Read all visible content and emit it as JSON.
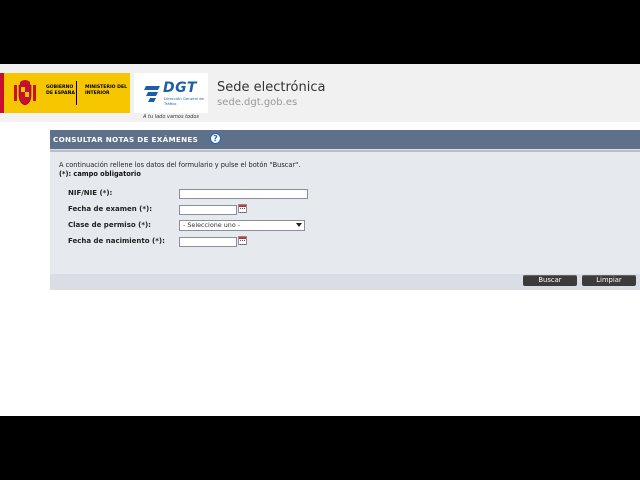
{
  "header": {
    "gov_line1": "GOBIERNO DE ESPAÑA",
    "gov_line2": "MINISTERIO DEL INTERIOR",
    "dgt_name": "DGT",
    "dgt_sub": "Dirección General de Tráfico",
    "tagline": "A tu lado vamos todos",
    "site_title": "Sede electrónica",
    "site_url": "sede.dgt.gob.es"
  },
  "panel": {
    "title": "CONSULTAR NOTAS DE EXÁMENES",
    "help_glyph": "?",
    "intro": "A continuación rellene los datos del formulario y pulse el botón \"Buscar\".",
    "required_note": "(*): campo obligatorio"
  },
  "form": {
    "nif_label": "NIF/NIE (*):",
    "exam_date_label": "Fecha de examen (*):",
    "permit_label": "Clase de permiso (*):",
    "permit_selected": "- Seleccione uno -",
    "birth_date_label": "Fecha de nacimiento (*):"
  },
  "actions": {
    "search_label": "Buscar",
    "clear_label": "Limpiar"
  },
  "colors": {
    "panel_header": "#5f708a",
    "gov_yellow": "#f6c701",
    "dgt_blue": "#1e5ea8"
  }
}
